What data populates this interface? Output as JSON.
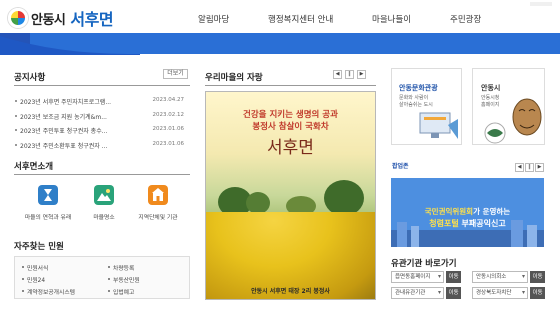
{
  "header": {
    "logo_city": "안동시",
    "logo_town": "서후면",
    "nav": [
      "알림마당",
      "행정복지센터 안내",
      "마을나들이",
      "주민광장"
    ]
  },
  "notices": {
    "title": "공지사항",
    "more_label": "더보기",
    "items": [
      {
        "text": "2023년 서후면 주민자치프로그램...",
        "date": "2023.04.27"
      },
      {
        "text": "2023년 보조금 지원 농기계&m...",
        "date": "2023.02.12"
      },
      {
        "text": "2023년 주민투표 청구권자 총수...",
        "date": "2023.01.06"
      },
      {
        "text": "2023년 주민소환투표 청구권자 ...",
        "date": "2023.01.06"
      }
    ]
  },
  "intro": {
    "title": "서후면소개",
    "items": [
      {
        "label": "마을의 연혁과 유래",
        "icon": "hourglass-icon",
        "color": "#2f7fc8"
      },
      {
        "label": "마을명소",
        "icon": "landscape-icon",
        "color": "#2aa37a"
      },
      {
        "label": "지역단체및 기관",
        "icon": "building-icon",
        "color": "#f08a1d"
      }
    ]
  },
  "faq": {
    "title": "자주찾는 민원",
    "items": [
      "민원서식",
      "차량등록",
      "민원24",
      "부동산민원",
      "계약정보공개시스템",
      "입법예고"
    ]
  },
  "village": {
    "title": "우리마을의 자랑",
    "controls": [
      "◀",
      "‖",
      "▶"
    ],
    "poster_line1": "건강을 지키는 생명의 공과",
    "poster_line2": "봉정사 참살이 국화차",
    "poster_town": "서후면",
    "poster_caption": "안동시 서후면 태장 2리 봉정사"
  },
  "banners": {
    "culture_title": "안동문화관광",
    "culture_sub1": "문화와 사람이",
    "culture_sub2": "살아숨쉬는 도시",
    "city_title": "안동시",
    "city_sub1": "안동시청",
    "city_sub2": "홈페이지"
  },
  "popup": {
    "label": "팝업존",
    "controls": [
      "◀",
      "‖",
      "▶"
    ],
    "line1_hi": "국민권익위원회",
    "line1_rest": "가 운영하는",
    "line2_hi": "청렴포털",
    "line2_rest": " 부패공익신고"
  },
  "related": {
    "title": "유관기관 바로가기",
    "select1": "읍면동홈페이지",
    "select2": "안동시의회소",
    "select3": "관내유관기관",
    "select4": "경상북도자치단",
    "go_label": "이동"
  }
}
